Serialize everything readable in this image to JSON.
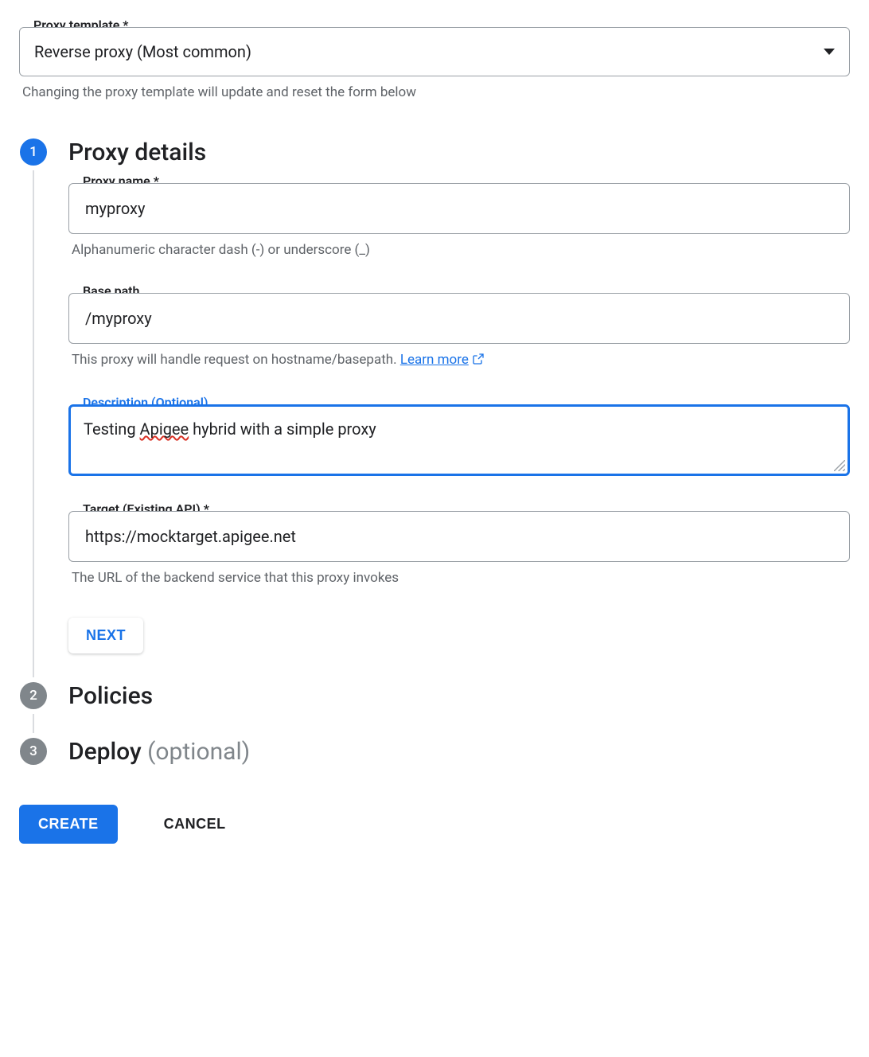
{
  "proxyTemplate": {
    "label": "Proxy template *",
    "value": "Reverse proxy (Most common)",
    "help": "Changing the proxy template will update and reset the form below"
  },
  "steps": {
    "s1": {
      "num": "1",
      "title": "Proxy details",
      "proxyName": {
        "label": "Proxy name *",
        "value": "myproxy",
        "help": "Alphanumeric character dash (-) or underscore (_)"
      },
      "basePath": {
        "label": "Base path",
        "value": "/myproxy",
        "help_pre": "This proxy will handle request on hostname/basepath. ",
        "learn": "Learn more"
      },
      "description": {
        "label": "Description (Optional)",
        "value_pre": "Testing ",
        "value_err": "Apigee",
        "value_post": " hybrid with a simple proxy"
      },
      "target": {
        "label": "Target (Existing API) *",
        "value": "https://mocktarget.apigee.net",
        "help": "The URL of the backend service that this proxy invokes"
      },
      "nextLabel": "NEXT"
    },
    "s2": {
      "num": "2",
      "title": "Policies"
    },
    "s3": {
      "num": "3",
      "title_main": "Deploy ",
      "title_opt": "(optional)"
    }
  },
  "footer": {
    "create": "CREATE",
    "cancel": "CANCEL"
  }
}
